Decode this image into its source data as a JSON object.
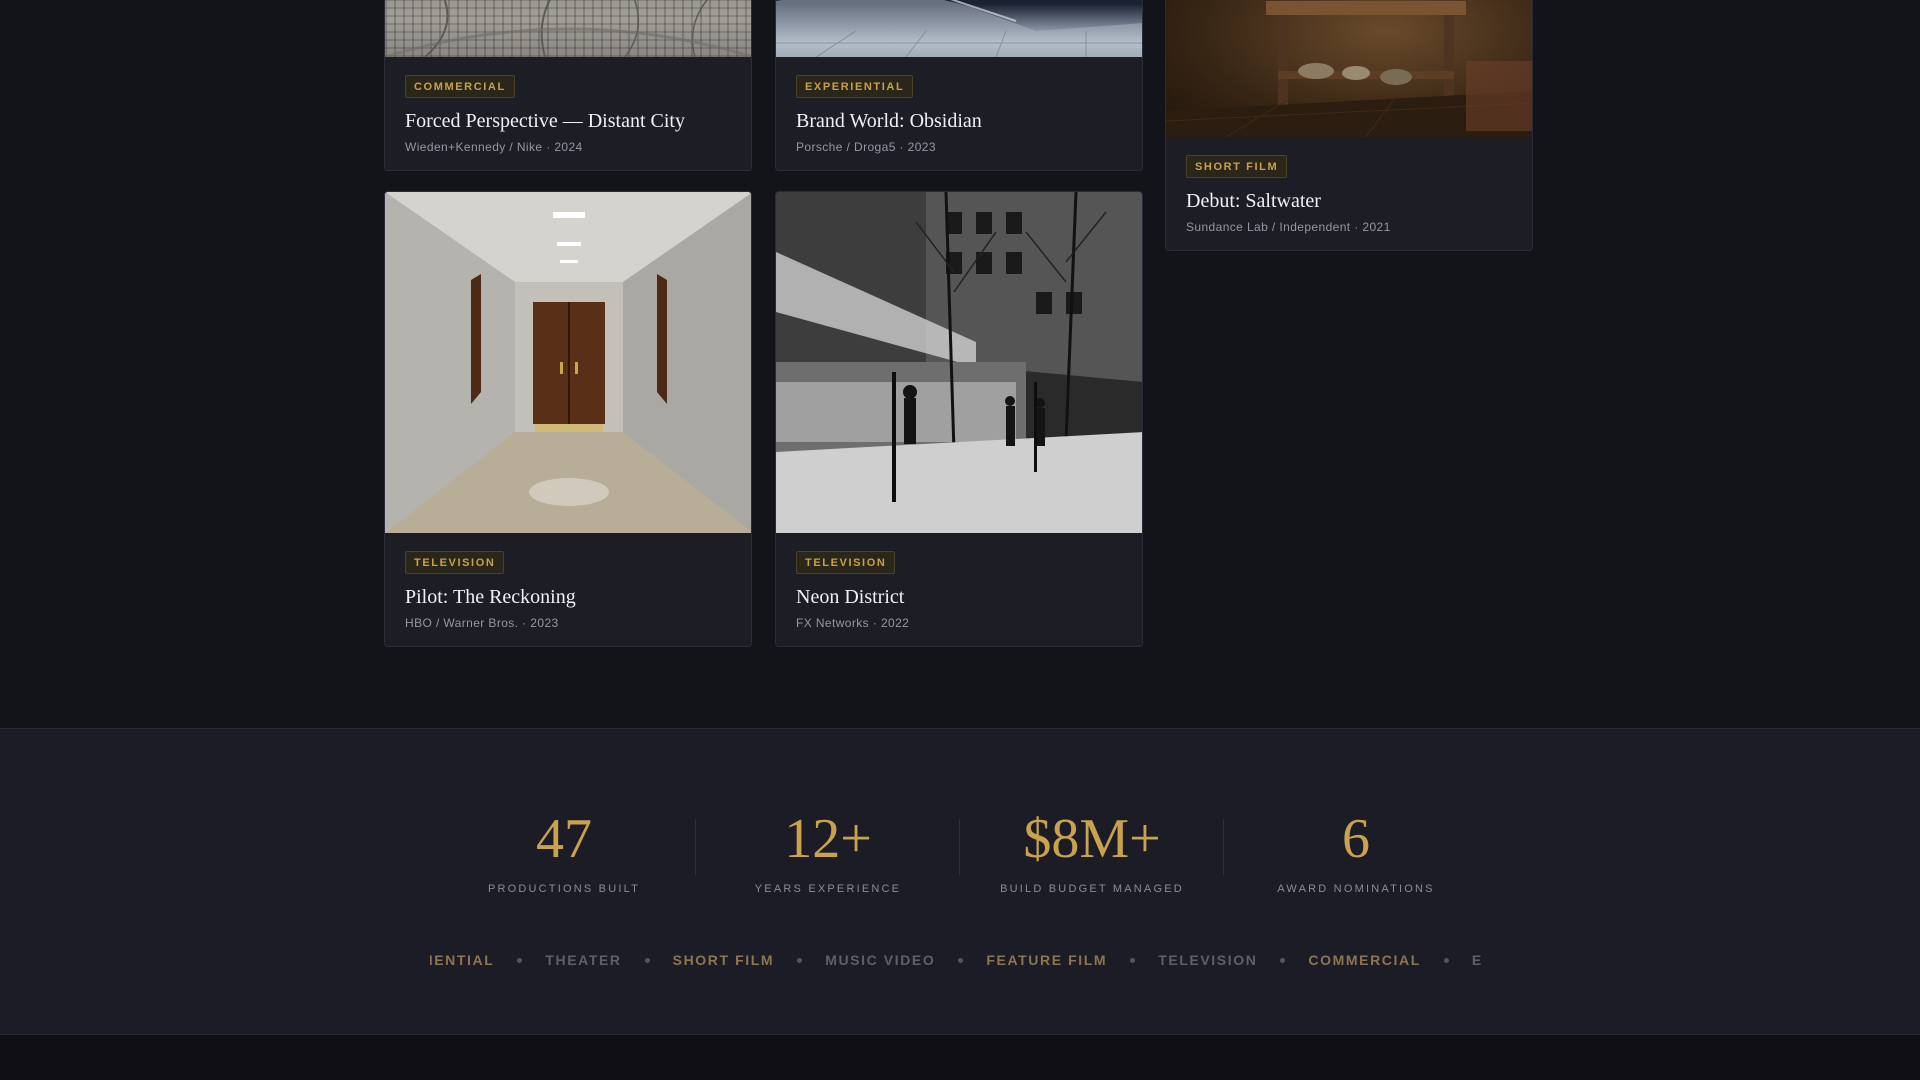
{
  "projects": [
    {
      "tag": "COMMERCIAL",
      "title": "Forced Perspective — Distant City",
      "meta": "Wieden+Kennedy / Nike · 2024"
    },
    {
      "tag": "EXPERIENTIAL",
      "title": "Brand World: Obsidian",
      "meta": "Porsche / Droga5 · 2023"
    },
    {
      "tag": "SHORT FILM",
      "title": "Debut: Saltwater",
      "meta": "Sundance Lab / Independent · 2021"
    },
    {
      "tag": "TELEVISION",
      "title": "Pilot: The Reckoning",
      "meta": "HBO / Warner Bros. · 2023"
    },
    {
      "tag": "TELEVISION",
      "title": "Neon District",
      "meta": "FX Networks · 2022"
    }
  ],
  "stats": [
    {
      "value": "47",
      "label": "PRODUCTIONS BUILT"
    },
    {
      "value": "12+",
      "label": "YEARS EXPERIENCE"
    },
    {
      "value": "$8M+",
      "label": "BUILD BUDGET MANAGED"
    },
    {
      "value": "6",
      "label": "AWARD NOMINATIONS"
    }
  ],
  "marquee": [
    {
      "text": "RIENTIAL",
      "color": "#8c7650"
    },
    {
      "text": "THEATER",
      "color": "#5f5f69"
    },
    {
      "text": "SHORT FILM",
      "color": "#8c7650"
    },
    {
      "text": "MUSIC VIDEO",
      "color": "#5f5f69"
    },
    {
      "text": "FEATURE FILM",
      "color": "#8c7650"
    },
    {
      "text": "TELEVISION",
      "color": "#5f5f69"
    },
    {
      "text": "COMMERCIAL",
      "color": "#8c7650"
    },
    {
      "text": "E",
      "color": "#5f5f69"
    }
  ],
  "colors": {
    "accent": "#c9a24e",
    "background": "#13131a",
    "card": "#1d1d26"
  }
}
